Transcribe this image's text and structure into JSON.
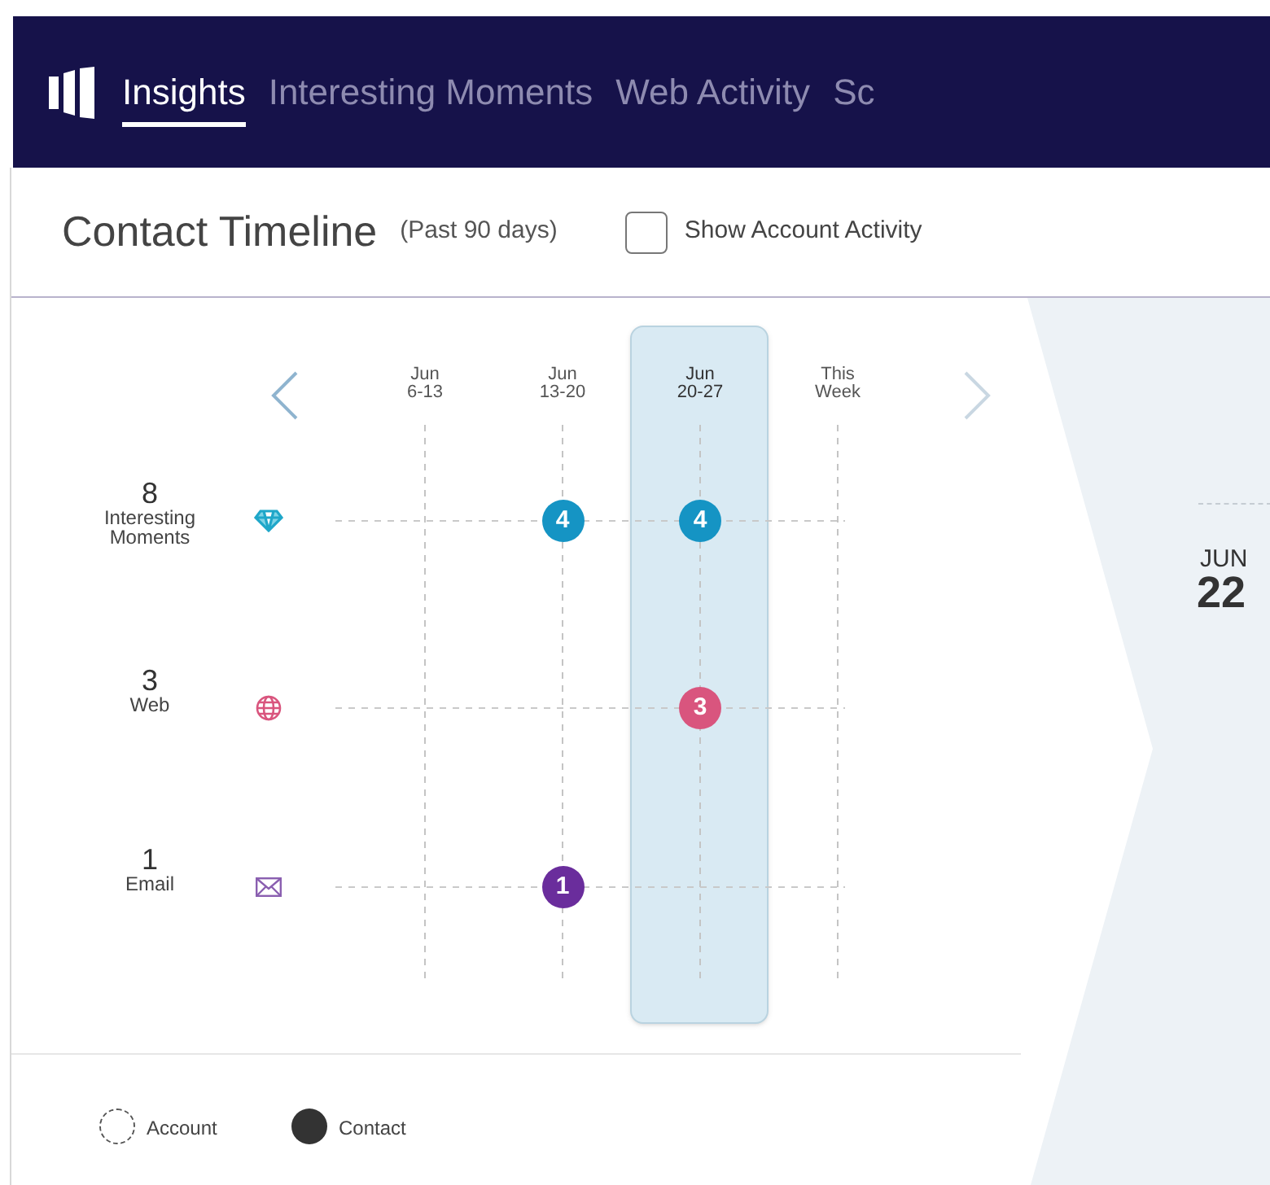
{
  "nav": {
    "tabs": [
      {
        "label": "Insights",
        "selected": true
      },
      {
        "label": "Interesting Moments",
        "selected": false
      },
      {
        "label": "Web Activity",
        "selected": false
      },
      {
        "label": "Sc",
        "selected": false
      }
    ]
  },
  "header": {
    "title": "Contact Timeline",
    "subtitle": "(Past 90 days)",
    "show_account_activity": {
      "label": "Show Account Activity",
      "checked": false
    }
  },
  "timeline": {
    "weeks": [
      {
        "line1": "Jun",
        "line2": "6-13",
        "selected": false
      },
      {
        "line1": "Jun",
        "line2": "13-20",
        "selected": false
      },
      {
        "line1": "Jun",
        "line2": "20-27",
        "selected": true
      },
      {
        "line1": "This",
        "line2": "Week",
        "selected": false
      }
    ],
    "rows": [
      {
        "count": "8",
        "label": "Interesting Moments",
        "kind": "diamond",
        "color": "#1594c4",
        "cells": [
          null,
          "4",
          "4",
          null
        ]
      },
      {
        "count": "3",
        "label": "Web",
        "kind": "globe",
        "color": "#d9557e",
        "cells": [
          null,
          null,
          "3",
          null
        ]
      },
      {
        "count": "1",
        "label": "Email",
        "kind": "email",
        "color": "#6a2d9c",
        "cells": [
          null,
          "1",
          null,
          null
        ]
      }
    ],
    "legend": [
      {
        "label": "Account",
        "kind": "dashed"
      },
      {
        "label": "Contact",
        "kind": "filled"
      }
    ]
  },
  "detail": {
    "month": "JUN",
    "day": "22"
  }
}
